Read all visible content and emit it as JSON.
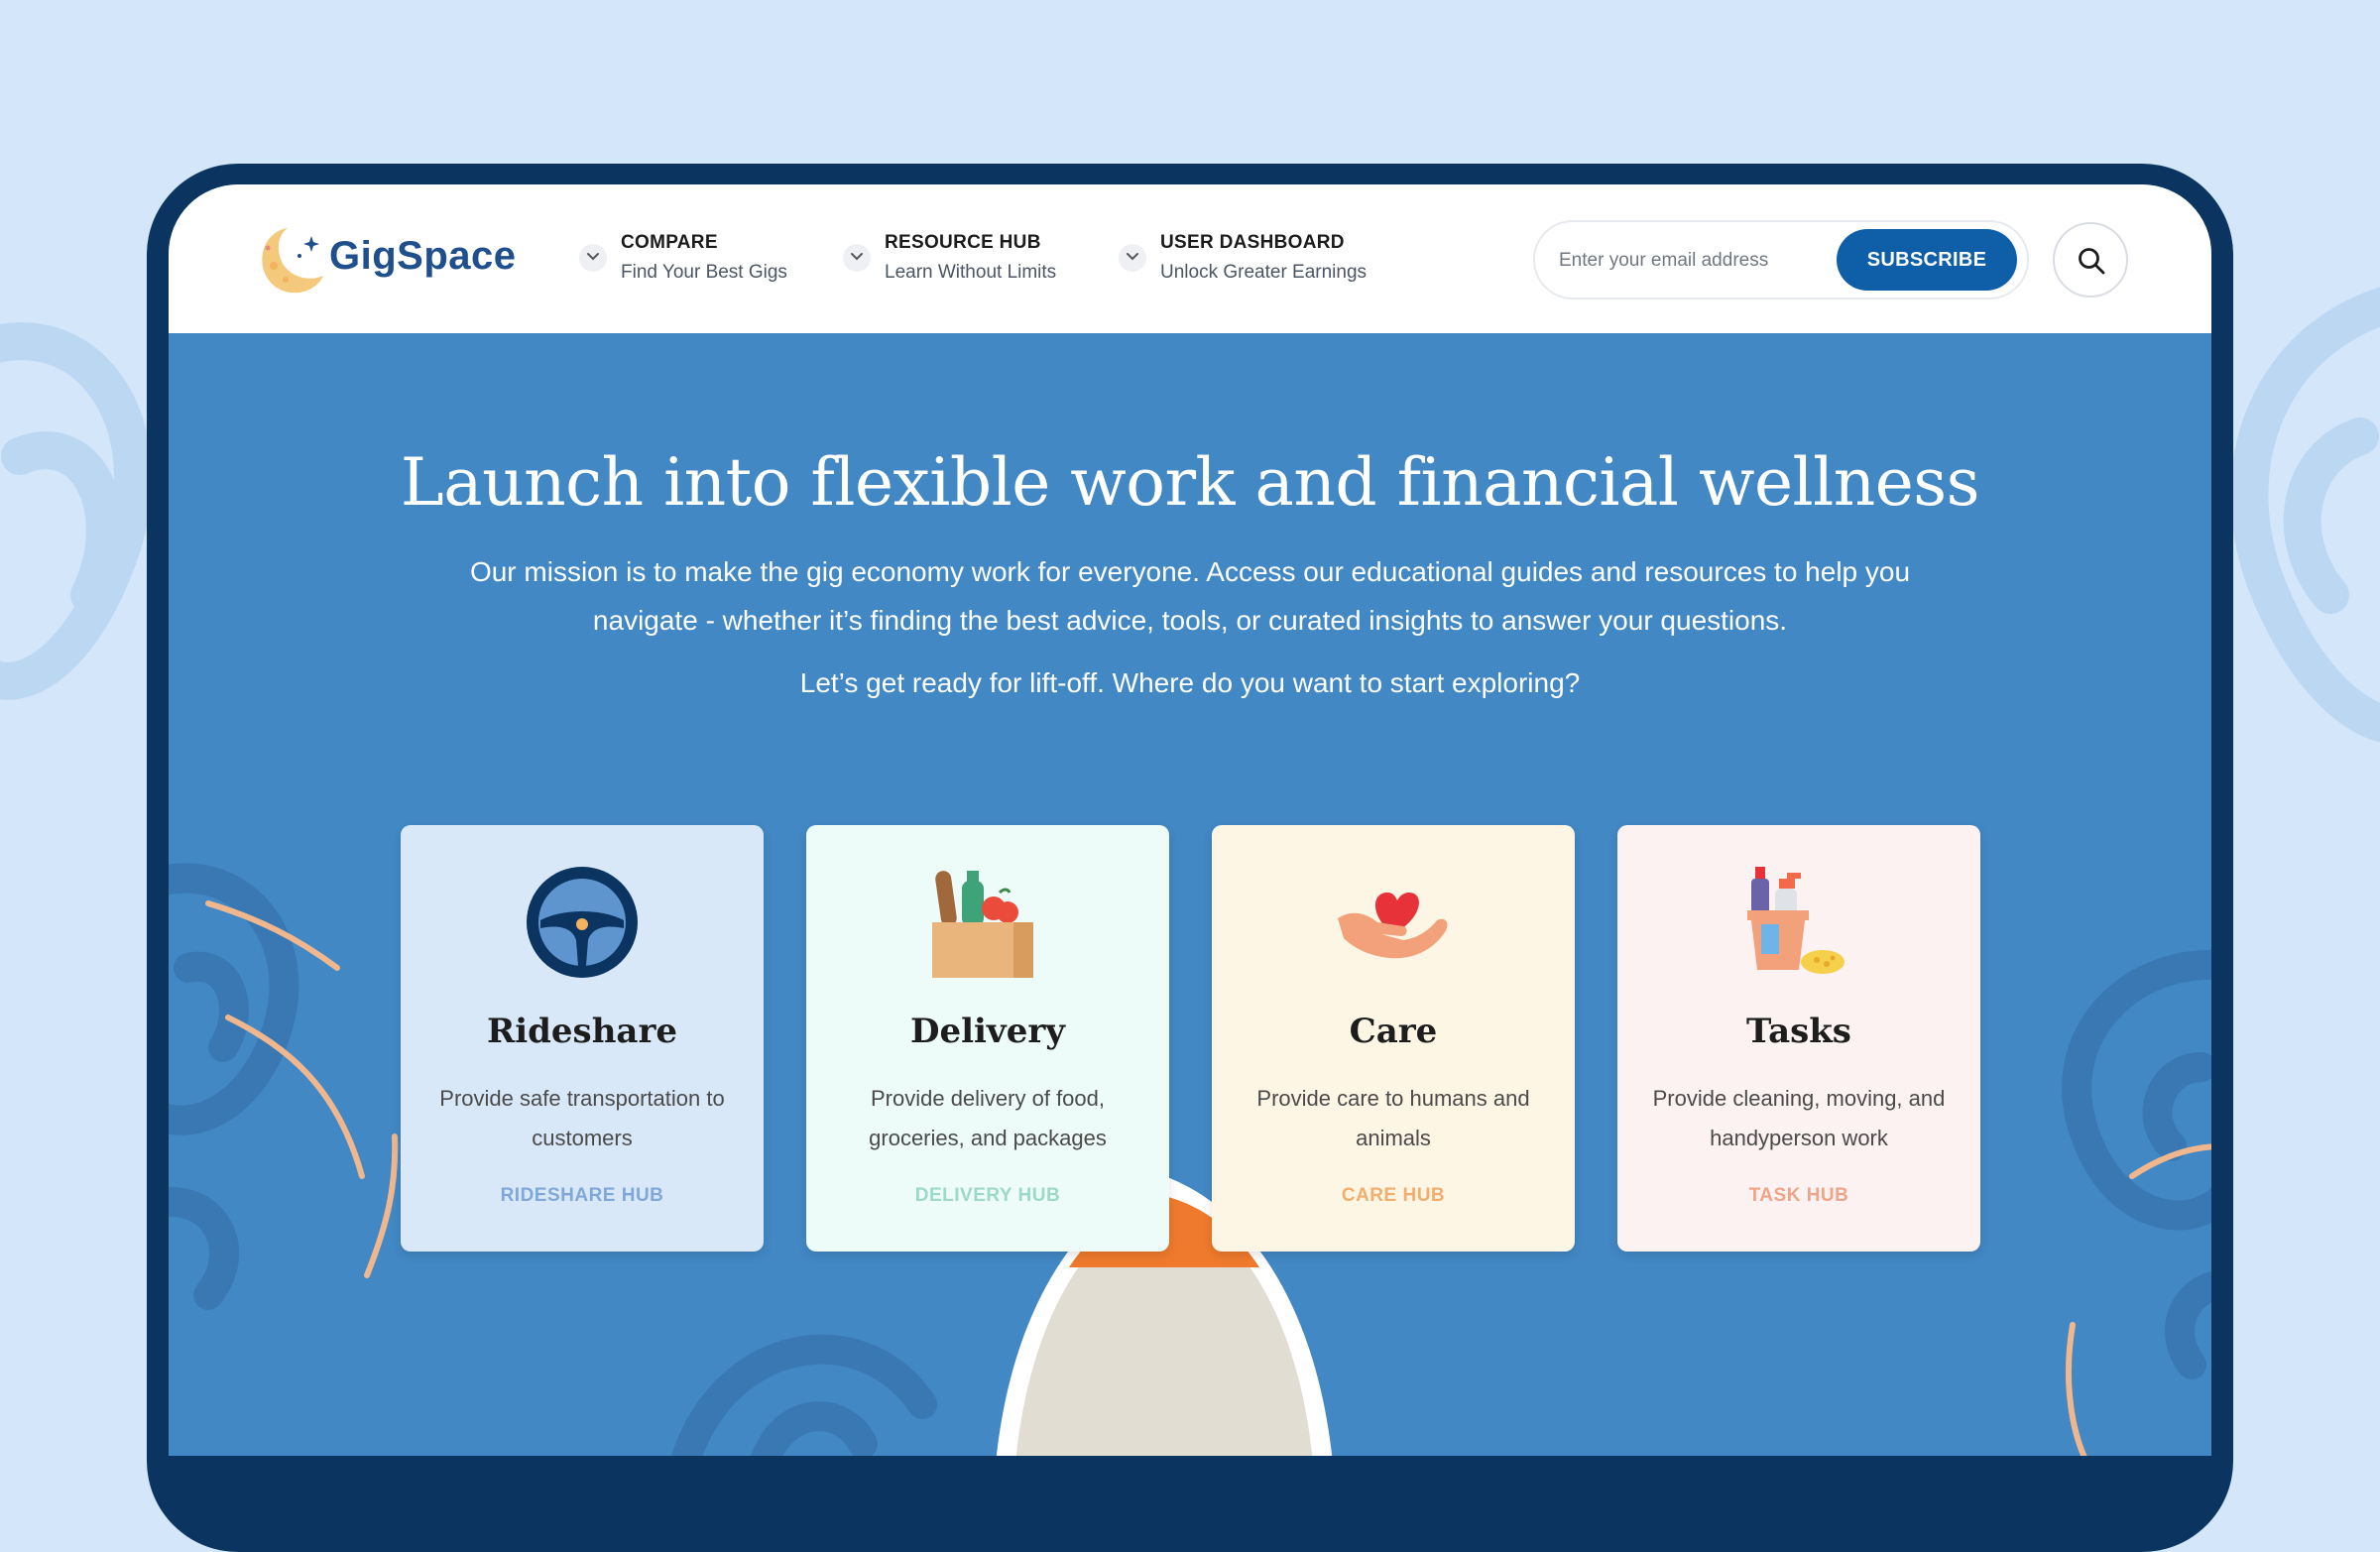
{
  "brand": {
    "name": "GigSpace"
  },
  "nav": [
    {
      "title": "COMPARE",
      "subtitle": "Find Your Best Gigs"
    },
    {
      "title": "RESOURCE HUB",
      "subtitle": "Learn Without Limits"
    },
    {
      "title": "USER DASHBOARD",
      "subtitle": "Unlock Greater Earnings"
    }
  ],
  "subscribe": {
    "placeholder": "Enter your email address",
    "button_label": "SUBSCRIBE"
  },
  "hero": {
    "title": "Launch into flexible work and financial wellness",
    "text": "Our mission is to make the gig economy work for everyone. Access our educational guides and resources to help you navigate - whether it’s finding the best advice, tools, or curated insights to answer your questions.",
    "prompt": "Let’s get ready for lift-off. Where do you want to start exploring?"
  },
  "cards": [
    {
      "title": "Rideshare",
      "description": "Provide safe transportation to customers",
      "link": "RIDESHARE HUB",
      "icon": "steering-wheel-icon",
      "bg": "#d9e8f8",
      "link_color": "#7fa8d8"
    },
    {
      "title": "Delivery",
      "description": "Provide delivery of food, groceries, and packages",
      "link": "DELIVERY HUB",
      "icon": "grocery-bag-icon",
      "bg": "#edfcf8",
      "link_color": "#9ed8c8"
    },
    {
      "title": "Care",
      "description": "Provide care to humans and animals",
      "link": "CARE HUB",
      "icon": "heart-hand-icon",
      "bg": "#fef6e5",
      "link_color": "#f3ad6c"
    },
    {
      "title": "Tasks",
      "description": "Provide cleaning, moving, and handyperson work",
      "link": "TASK HUB",
      "icon": "cleaning-bucket-icon",
      "bg": "#fcf2f2",
      "link_color": "#f0a488"
    }
  ],
  "colors": {
    "page_bg": "#d3e6fa",
    "device_frame": "#0b3560",
    "hero_bg": "#4288c5",
    "brand_blue": "#1f4f8c",
    "subscribe_button": "#0f5ea8"
  }
}
